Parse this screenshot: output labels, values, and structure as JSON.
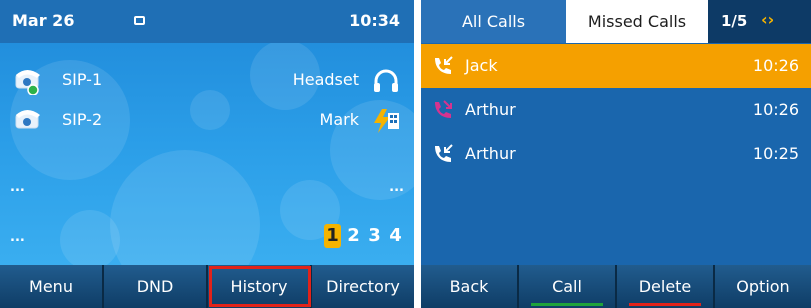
{
  "left": {
    "status": {
      "date": "Mar 26",
      "time": "10:34"
    },
    "lines": [
      {
        "label": "SIP-1",
        "right_label": "Headset",
        "icon": "phone-icon",
        "right_icon": "headset-icon"
      },
      {
        "label": "SIP-2",
        "right_label": "Mark",
        "icon": "phone-icon",
        "right_icon": "blf-icon"
      }
    ],
    "ellipsis": "...",
    "pages": [
      "1",
      "2",
      "3",
      "4"
    ],
    "active_page": "1",
    "softkeys": [
      "Menu",
      "DND",
      "History",
      "Directory"
    ]
  },
  "right": {
    "tabs": {
      "all": "All Calls",
      "missed": "Missed Calls"
    },
    "pager": "1/5",
    "arrows": "‹›",
    "calls": [
      {
        "name": "Jack",
        "time": "10:26",
        "type": "received",
        "icon_color": "#ffffff",
        "selected": true
      },
      {
        "name": "Arthur",
        "time": "10:26",
        "type": "missed",
        "icon_color": "#d6338f",
        "selected": false
      },
      {
        "name": "Arthur",
        "time": "10:25",
        "type": "received",
        "icon_color": "#ffffff",
        "selected": false
      }
    ],
    "softkeys": [
      {
        "label": "Back",
        "underline": ""
      },
      {
        "label": "Call",
        "underline": "#1fa33a"
      },
      {
        "label": "Delete",
        "underline": "#e2231a"
      },
      {
        "label": "Option",
        "underline": ""
      }
    ]
  },
  "colors": {
    "accent": "#f5a000",
    "highlight": "#e2231a"
  }
}
